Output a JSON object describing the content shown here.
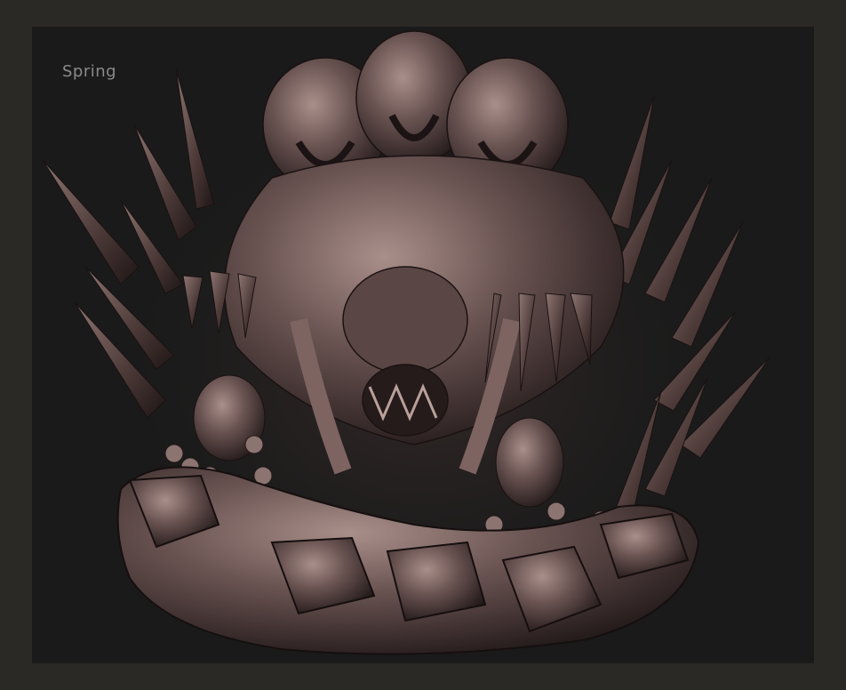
{
  "viewport": {
    "caption": "Spring",
    "caption_color": "#8a8a8a",
    "background_color": "#1a1a1a",
    "frame_color": "#2b2925"
  },
  "sculpture": {
    "material_color": "#6a5452",
    "highlight_color": "#b9a09a",
    "shadow_color": "#2a1f1f"
  }
}
